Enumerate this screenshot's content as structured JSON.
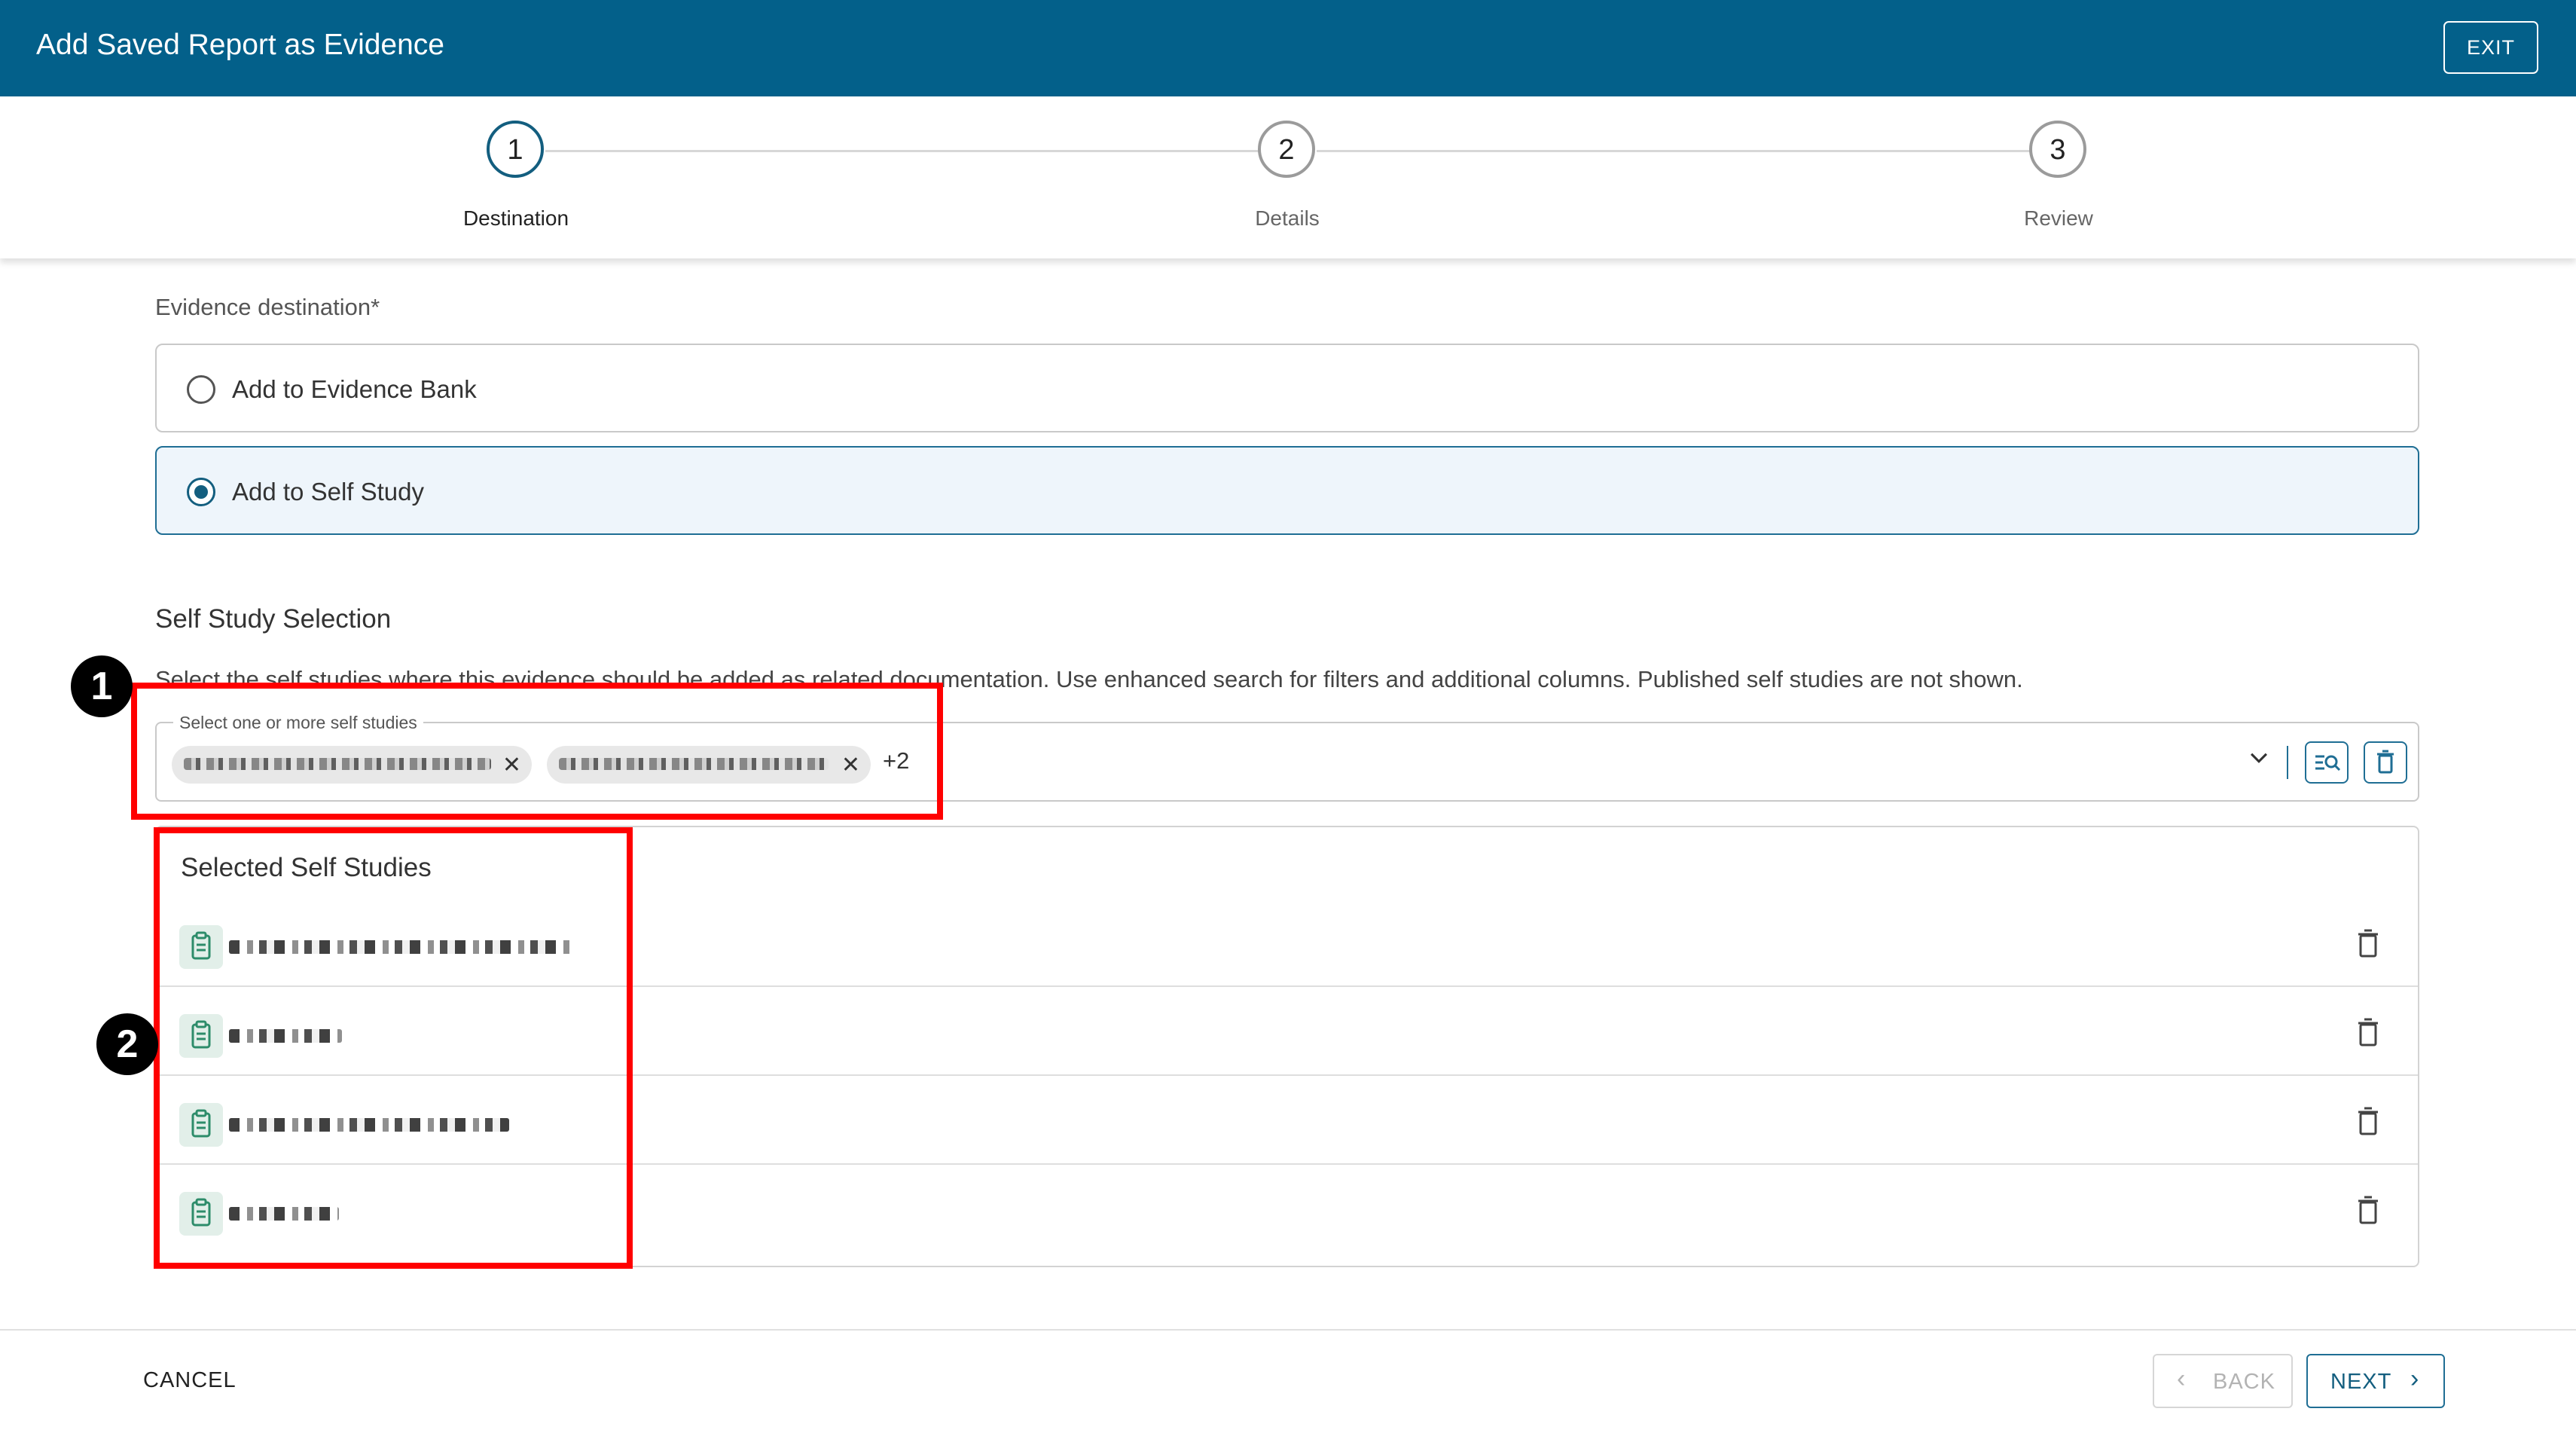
{
  "header": {
    "title": "Add Saved Report as Evidence",
    "exit_label": "EXIT"
  },
  "stepper": {
    "steps": [
      {
        "number": "1",
        "label": "Destination",
        "state": "active"
      },
      {
        "number": "2",
        "label": "Details",
        "state": "inactive"
      },
      {
        "number": "3",
        "label": "Review",
        "state": "inactive"
      }
    ]
  },
  "destination": {
    "label": "Evidence destination",
    "required_mark": "*",
    "options": [
      {
        "label": "Add to Evidence Bank",
        "selected": false
      },
      {
        "label": "Add to Self Study",
        "selected": true
      }
    ]
  },
  "self_study": {
    "section_title": "Self Study Selection",
    "help_text": "Select the self studies where this evidence should be added as related documentation. Use enhanced search for filters and additional columns. Published self studies are not shown.",
    "select_legend": "Select one or more self studies",
    "chips": [
      {
        "remove_glyph": "✕"
      },
      {
        "remove_glyph": "✕"
      }
    ],
    "more_count": "+2",
    "dropdown_glyph": "⌄"
  },
  "selected_list": {
    "title": "Selected Self Studies",
    "row_count": 4
  },
  "annotations": {
    "marker_1": "1",
    "marker_2": "2"
  },
  "footer": {
    "cancel_label": "CANCEL",
    "back_label": "BACK",
    "next_label": "NEXT",
    "back_glyph": "‹",
    "next_glyph": "›"
  },
  "colors": {
    "brand": "#03608a",
    "accent": "#135e7f",
    "selected_bg": "#eef5fb",
    "annotation_red": "#ff0000",
    "doc_icon": "#2d8c6a"
  }
}
